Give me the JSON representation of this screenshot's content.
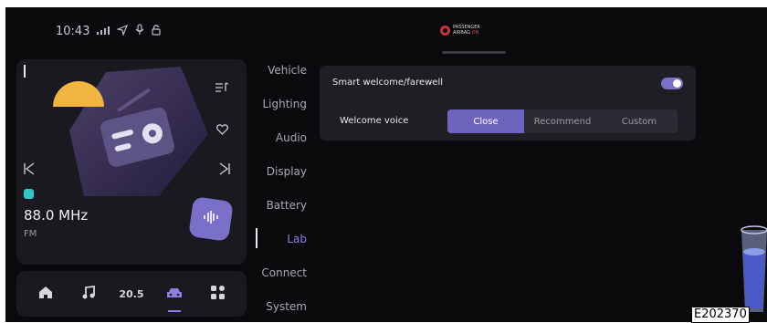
{
  "status_bar": {
    "time": "10:43",
    "icons": [
      "signal-icon",
      "navigation-icon",
      "microphone-icon",
      "lock-icon"
    ],
    "airbag": {
      "line1": "PASSENGER",
      "line2": "AIRBAG",
      "state": "ON"
    }
  },
  "media": {
    "frequency": "88.0 MHz",
    "band": "FM",
    "icons": [
      "playlist-icon",
      "favorite-heart-icon",
      "previous-icon",
      "next-icon",
      "voice-icon",
      "radio-source-icon"
    ]
  },
  "dock": {
    "temperature": "20.5",
    "items": [
      "home-icon",
      "music-icon",
      "temperature",
      "car-icon",
      "apps-icon"
    ],
    "active": "car-icon"
  },
  "settings_nav": {
    "items": [
      "Vehicle",
      "Lighting",
      "Audio",
      "Display",
      "Battery",
      "Lab",
      "Connect",
      "System"
    ],
    "active": "Lab"
  },
  "lab_panel": {
    "smart_welcome_label": "Smart welcome/farewell",
    "smart_welcome_enabled": true,
    "welcome_voice_label": "Welcome voice",
    "welcome_voice_options": [
      "Close",
      "Recommend",
      "Custom"
    ],
    "welcome_voice_selected": "Close"
  },
  "figure_code": "E202370",
  "colors": {
    "accent": "#7a6fc9",
    "background": "#0a0a0d",
    "card": "#19191f",
    "panel": "#1e1e24"
  }
}
